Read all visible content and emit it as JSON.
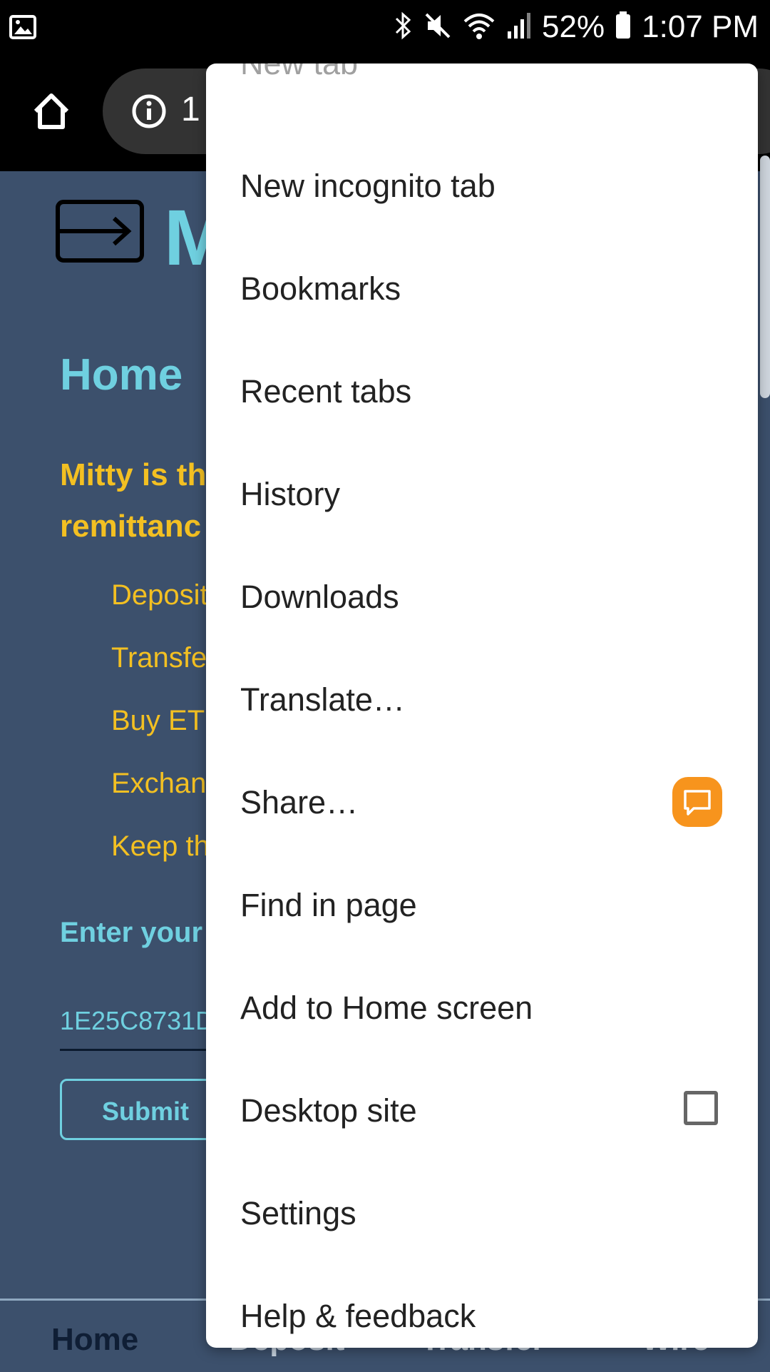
{
  "status_bar": {
    "battery": "52%",
    "time": "1:07 PM"
  },
  "toolbar": {
    "url_fragment": "1"
  },
  "page": {
    "brand_fragment": "M",
    "title": "Home",
    "intro_line1": "Mitty is th",
    "intro_line2": "remittanc",
    "features": [
      "Deposit",
      "Transfe",
      "Buy ET",
      "Exchan",
      "Keep th"
    ],
    "enter_label": "Enter your",
    "address_value": "1E25C8731D",
    "submit_label": "Submit",
    "nav": [
      "Home",
      "Deposit",
      "Transfer",
      "Wire"
    ]
  },
  "menu": {
    "items": [
      "New tab",
      "New incognito tab",
      "Bookmarks",
      "Recent tabs",
      "History",
      "Downloads",
      "Translate…",
      "Share…",
      "Find in page",
      "Add to Home screen",
      "Desktop site",
      "Settings",
      "Help & feedback"
    ]
  },
  "colors": {
    "page_bg": "#3c506c",
    "accent_cyan": "#6fd0e0",
    "accent_yellow": "#f3c022",
    "share_orange": "#f7941d"
  }
}
